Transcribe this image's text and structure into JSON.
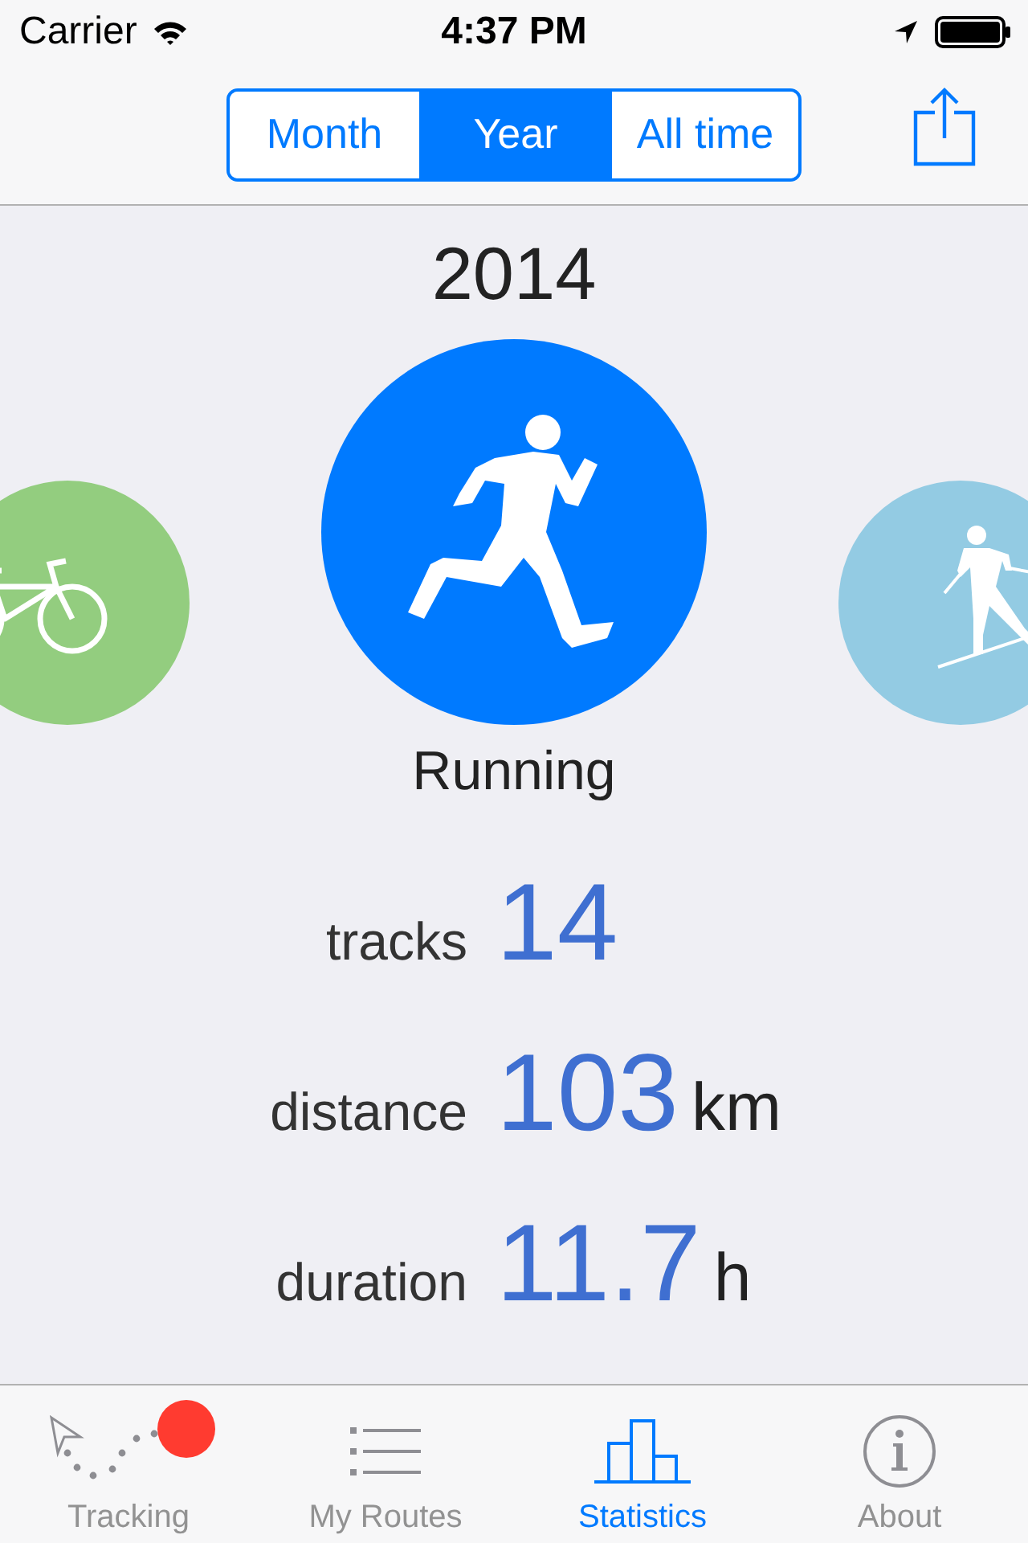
{
  "status_bar": {
    "carrier": "Carrier",
    "time": "4:37 PM"
  },
  "period_tabs": [
    {
      "label": "Month",
      "selected": false
    },
    {
      "label": "Year",
      "selected": true
    },
    {
      "label": "All time",
      "selected": false
    }
  ],
  "year": "2014",
  "activities": [
    {
      "kind": "cycling",
      "color": "#93cd7f",
      "selected": false
    },
    {
      "kind": "running",
      "color": "#007aff",
      "selected": true
    },
    {
      "kind": "skiing",
      "color": "#93cbe3",
      "selected": false
    }
  ],
  "activity_name": "Running",
  "stats": [
    {
      "label": "tracks",
      "value": "14"
    },
    {
      "label": "distance",
      "value": "103",
      "unit": "km"
    },
    {
      "label": "duration",
      "value": "11.7",
      "unit": "h"
    }
  ],
  "tab_bar": [
    {
      "kind": "tracking",
      "label": "Tracking",
      "selected": false,
      "badge": true
    },
    {
      "kind": "routes",
      "label": "My Routes",
      "selected": false,
      "badge": false
    },
    {
      "kind": "statistics",
      "label": "Statistics",
      "selected": true,
      "badge": false
    },
    {
      "kind": "about",
      "label": "About",
      "selected": false,
      "badge": false
    }
  ]
}
